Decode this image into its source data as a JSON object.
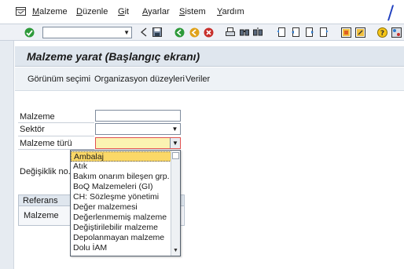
{
  "menubar": {
    "items": [
      {
        "label": "Malzeme",
        "underline": "M"
      },
      {
        "label": "Düzenle",
        "underline": "D"
      },
      {
        "label": "Git",
        "underline": "G"
      },
      {
        "label": "Ayarlar",
        "underline": "A"
      },
      {
        "label": "Sistem",
        "underline": "S"
      },
      {
        "label": "Yardım",
        "underline": "Y"
      }
    ]
  },
  "corner_mark": "/",
  "toolbar": {
    "enter_icon": "check-icon",
    "command_field_value": "",
    "buttons": [
      "back-arrow-icon",
      "save-icon",
      "back-icon",
      "exit-icon",
      "cancel-icon",
      "print-icon",
      "find-icon",
      "find-next-icon",
      "first-page-icon",
      "previous-page-icon",
      "next-page-icon",
      "last-page-icon",
      "create-session-icon",
      "shortcut-icon",
      "help-icon",
      "customize-icon"
    ]
  },
  "screen": {
    "title": "Malzeme yarat (Başlangıç ekranı)"
  },
  "appbar": {
    "buttons": [
      "Görünüm seçimi",
      "Organizasyon düzeyleri",
      "Veriler"
    ]
  },
  "form": {
    "material_label": "Malzeme",
    "material_value": "",
    "sector_label": "Sektör",
    "sector_value": "",
    "material_type_label": "Malzeme türü",
    "material_type_value": "",
    "change_no_label": "Değişiklik no."
  },
  "reference": {
    "header": "Referans",
    "material_label": "Malzeme"
  },
  "dropdown": {
    "selected_index": 0,
    "options": [
      "Ambalaj",
      "Atık",
      "Bakım onarım bileşen grp.",
      "BoQ Malzemeleri (GI)",
      "CH: Sözleşme yönetimi",
      "Değer malzemesi",
      "Değerlenmemiş malzeme",
      "Değiştirilebilir malzeme",
      "Depolanmayan malzeme",
      "Dolu İAM"
    ]
  },
  "colors": {
    "focused_field": "#fbf3b2",
    "selected_option": "#fbd867",
    "title_bar": "#dfe6ee",
    "corner_mark": "#1f3fbf"
  }
}
